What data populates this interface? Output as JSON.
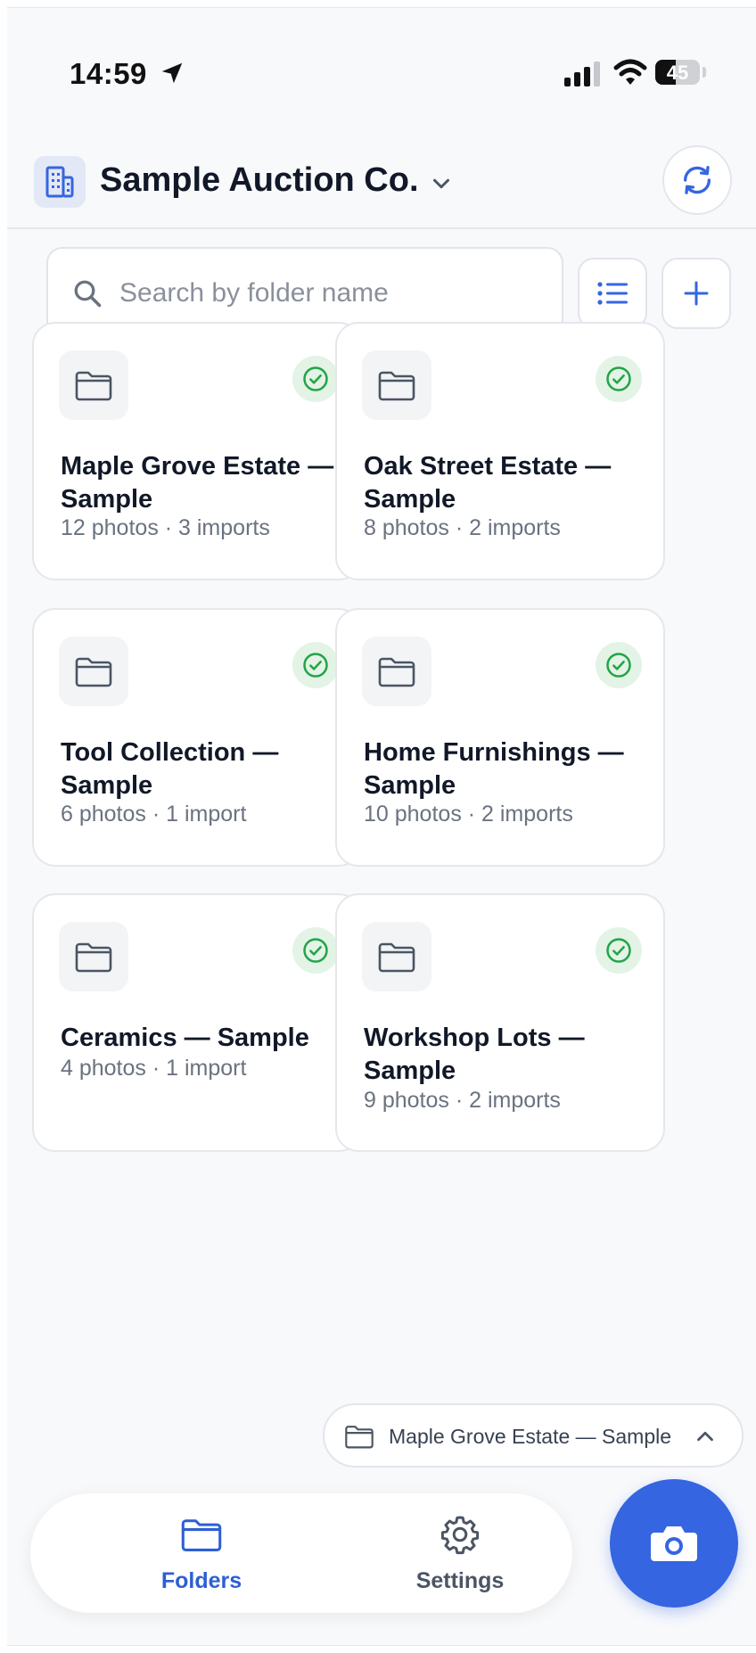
{
  "status_bar": {
    "time": "14:59",
    "battery": "45",
    "battery_fraction": 0.45
  },
  "header": {
    "org_name": "Sample Auction Co."
  },
  "search": {
    "placeholder": "Search by folder name"
  },
  "folders": [
    {
      "title": "Maple Grove Estate — Sample",
      "meta": "12 photos · 3 imports"
    },
    {
      "title": "Oak Street Estate — Sample",
      "meta": "8 photos · 2 imports"
    },
    {
      "title": "Tool Collection — Sample",
      "meta": "6 photos · 1 import"
    },
    {
      "title": "Home Furnishings — Sample",
      "meta": "10 photos · 2 imports"
    },
    {
      "title": "Ceramics — Sample",
      "meta": "4 photos · 1 import"
    },
    {
      "title": "Workshop Lots — Sample",
      "meta": "9 photos · 2 imports"
    }
  ],
  "current_folder": {
    "label": "Maple Grove Estate — Sample"
  },
  "tabbar": {
    "folders_label": "Folders",
    "settings_label": "Settings"
  },
  "colors": {
    "accent": "#3565e0",
    "accent_text": "#2d5fd4",
    "success": "#22a447",
    "success_bg": "#e3f3e6"
  },
  "icons": [
    "location-arrow-icon",
    "signal-icon",
    "wifi-icon",
    "building-icon",
    "chevron-down-icon",
    "sync-icon",
    "search-icon",
    "list-icon",
    "plus-icon",
    "folder-icon",
    "check-circle-icon",
    "chevron-up-icon",
    "gear-icon",
    "camera-icon"
  ]
}
